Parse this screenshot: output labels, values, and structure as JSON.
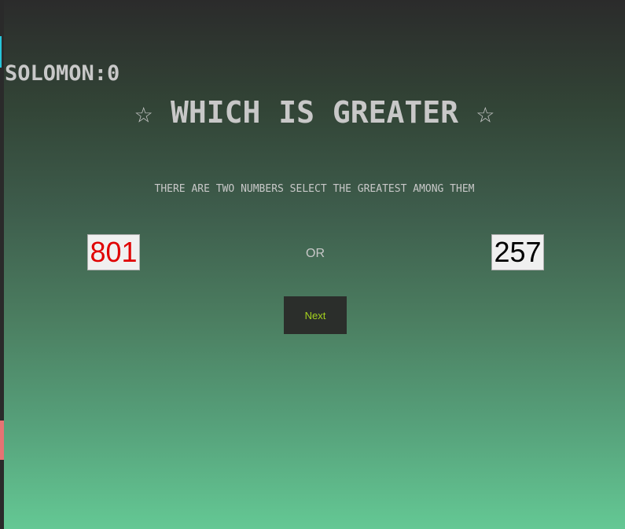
{
  "score": {
    "text": "SOLOMON:0"
  },
  "title": {
    "text": "☆ WHICH IS GREATER ☆"
  },
  "instructions": {
    "text": "THERE ARE TWO NUMBERS SELECT THE GREATEST AMONG THEM"
  },
  "choices": {
    "left": {
      "value": "801",
      "color": "#e00000"
    },
    "separator": "OR",
    "right": {
      "value": "257",
      "color": "#000000"
    }
  },
  "next_button": {
    "label": "Next",
    "text_color": "#a5d21e"
  },
  "colors": {
    "background_top": "#2b2b2b",
    "background_bottom": "#64c894",
    "text": "#c8c8c8"
  }
}
